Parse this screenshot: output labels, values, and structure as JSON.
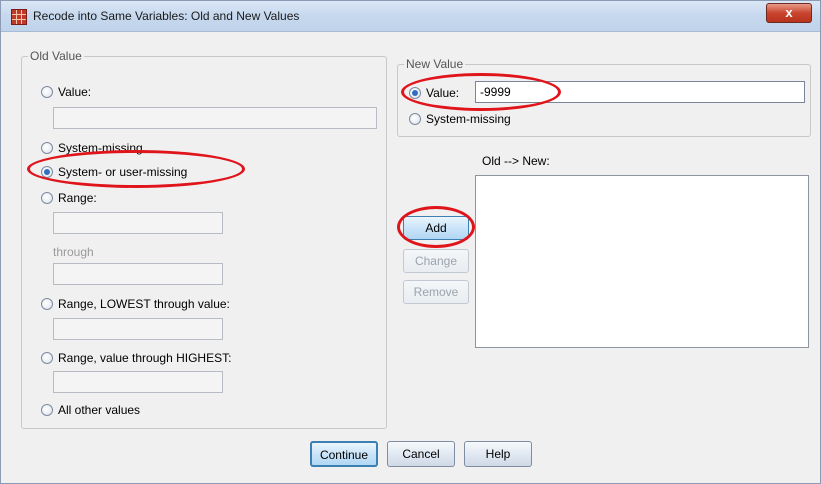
{
  "window": {
    "title": "Recode into Same Variables: Old and New Values",
    "close_glyph": "x"
  },
  "old_value": {
    "legend": "Old Value",
    "value_label": "Value:",
    "system_missing_label": "System-missing",
    "sys_user_missing_label": "System- or user-missing",
    "range_label": "Range:",
    "through_label": "through",
    "range_lowest_label": "Range, LOWEST through value:",
    "range_highest_label": "Range, value through HIGHEST:",
    "all_other_label": "All other values",
    "selected": "System- or user-missing"
  },
  "new_value": {
    "legend": "New Value",
    "value_label": "Value:",
    "value": "-9999",
    "system_missing_label": "System-missing",
    "selected": "Value"
  },
  "mapping": {
    "label": "Old --> New:",
    "items": []
  },
  "buttons": {
    "add": "Add",
    "change": "Change",
    "remove": "Remove",
    "continue": "Continue",
    "cancel": "Cancel",
    "help": "Help"
  },
  "colors": {
    "annotation_ring": "#e0141b",
    "radio_selected": "#2f6fc2"
  }
}
